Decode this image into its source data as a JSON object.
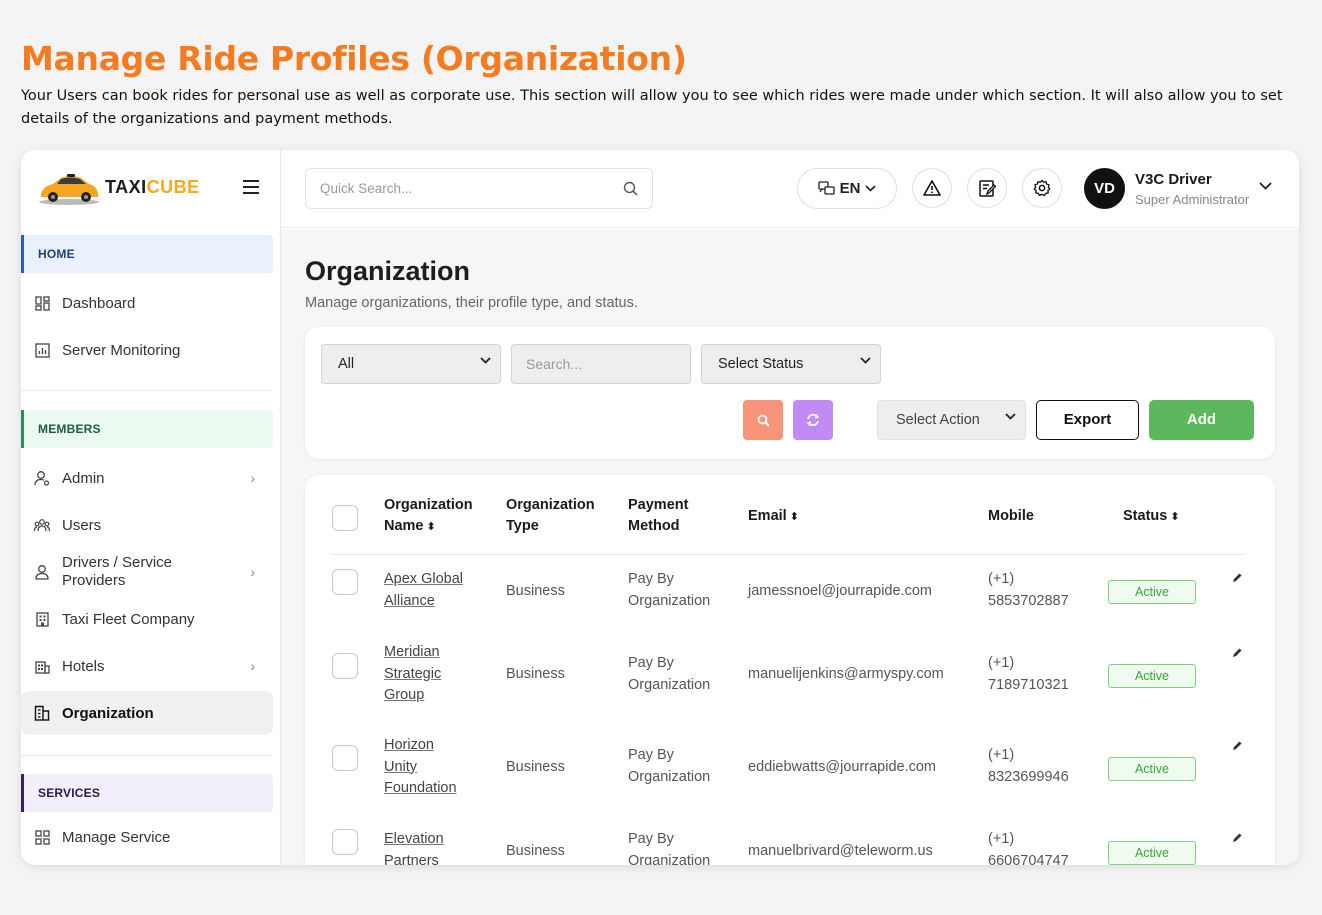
{
  "page": {
    "title": "Manage Ride Profiles (Organization)",
    "description": "Your Users can book rides for personal use as well as corporate use. This section will allow you to see which rides were made under which section. It will also allow you to set details of the organizations and payment methods."
  },
  "brand": {
    "name_part1": "TAXI",
    "name_part2": "CUBE",
    "accent": "#f6a81b"
  },
  "sidebar": {
    "sections": {
      "home": "HOME",
      "members": "MEMBERS",
      "services": "SERVICES"
    },
    "items": {
      "dashboard": "Dashboard",
      "server_monitoring": "Server Monitoring",
      "admin": "Admin",
      "users": "Users",
      "drivers_line1": "Drivers / Service",
      "drivers_line2": "Providers",
      "taxi_fleet": "Taxi Fleet Company",
      "hotels": "Hotels",
      "organization": "Organization",
      "manage_service": "Manage Service"
    }
  },
  "topbar": {
    "search_placeholder": "Quick Search...",
    "language": "EN",
    "avatar_initials": "VD",
    "user_name": "V3C Driver",
    "user_role": "Super Administrator"
  },
  "main": {
    "title": "Organization",
    "subtitle": "Manage organizations, their profile type, and status.",
    "filters": {
      "type_select": "All",
      "search_placeholder": "Search...",
      "status_select": "Select Status",
      "action_select": "Select Action",
      "export_label": "Export",
      "add_label": "Add"
    },
    "table": {
      "headers": {
        "org_name_l1": "Organization",
        "org_name_l2": "Name",
        "org_type_l1": "Organization",
        "org_type_l2": "Type",
        "payment_l1": "Payment",
        "payment_l2": "Method",
        "email": "Email",
        "mobile": "Mobile",
        "status": "Status"
      },
      "rows": [
        {
          "name_lines": [
            "Apex Global",
            "Alliance"
          ],
          "type": "Business",
          "payment_l1": "Pay By",
          "payment_l2": "Organization",
          "email": "jamessnoel@jourrapide.com",
          "mobile_l1": "(+1)",
          "mobile_l2": "5853702887",
          "status": "Active"
        },
        {
          "name_lines": [
            "Meridian",
            "Strategic",
            "Group"
          ],
          "type": "Business",
          "payment_l1": "Pay By",
          "payment_l2": "Organization",
          "email": "manuelijenkins@armyspy.com",
          "mobile_l1": "(+1)",
          "mobile_l2": "7189710321",
          "status": "Active"
        },
        {
          "name_lines": [
            "Horizon",
            "Unity",
            "Foundation"
          ],
          "type": "Business",
          "payment_l1": "Pay By",
          "payment_l2": "Organization",
          "email": "eddiebwatts@jourrapide.com",
          "mobile_l1": "(+1)",
          "mobile_l2": "8323699946",
          "status": "Active"
        },
        {
          "name_lines": [
            "Elevation",
            "Partners"
          ],
          "type": "Business",
          "payment_l1": "Pay By",
          "payment_l2": "Organization",
          "email": "manuelbrivard@teleworm.us",
          "mobile_l1": "(+1)",
          "mobile_l2": "6606704747",
          "status": "Active"
        }
      ]
    }
  },
  "colors": {
    "title_orange": "#f47b20",
    "add_green": "#5cb85c",
    "search_btn": "#f7947a",
    "refresh_btn": "#c18af5"
  }
}
